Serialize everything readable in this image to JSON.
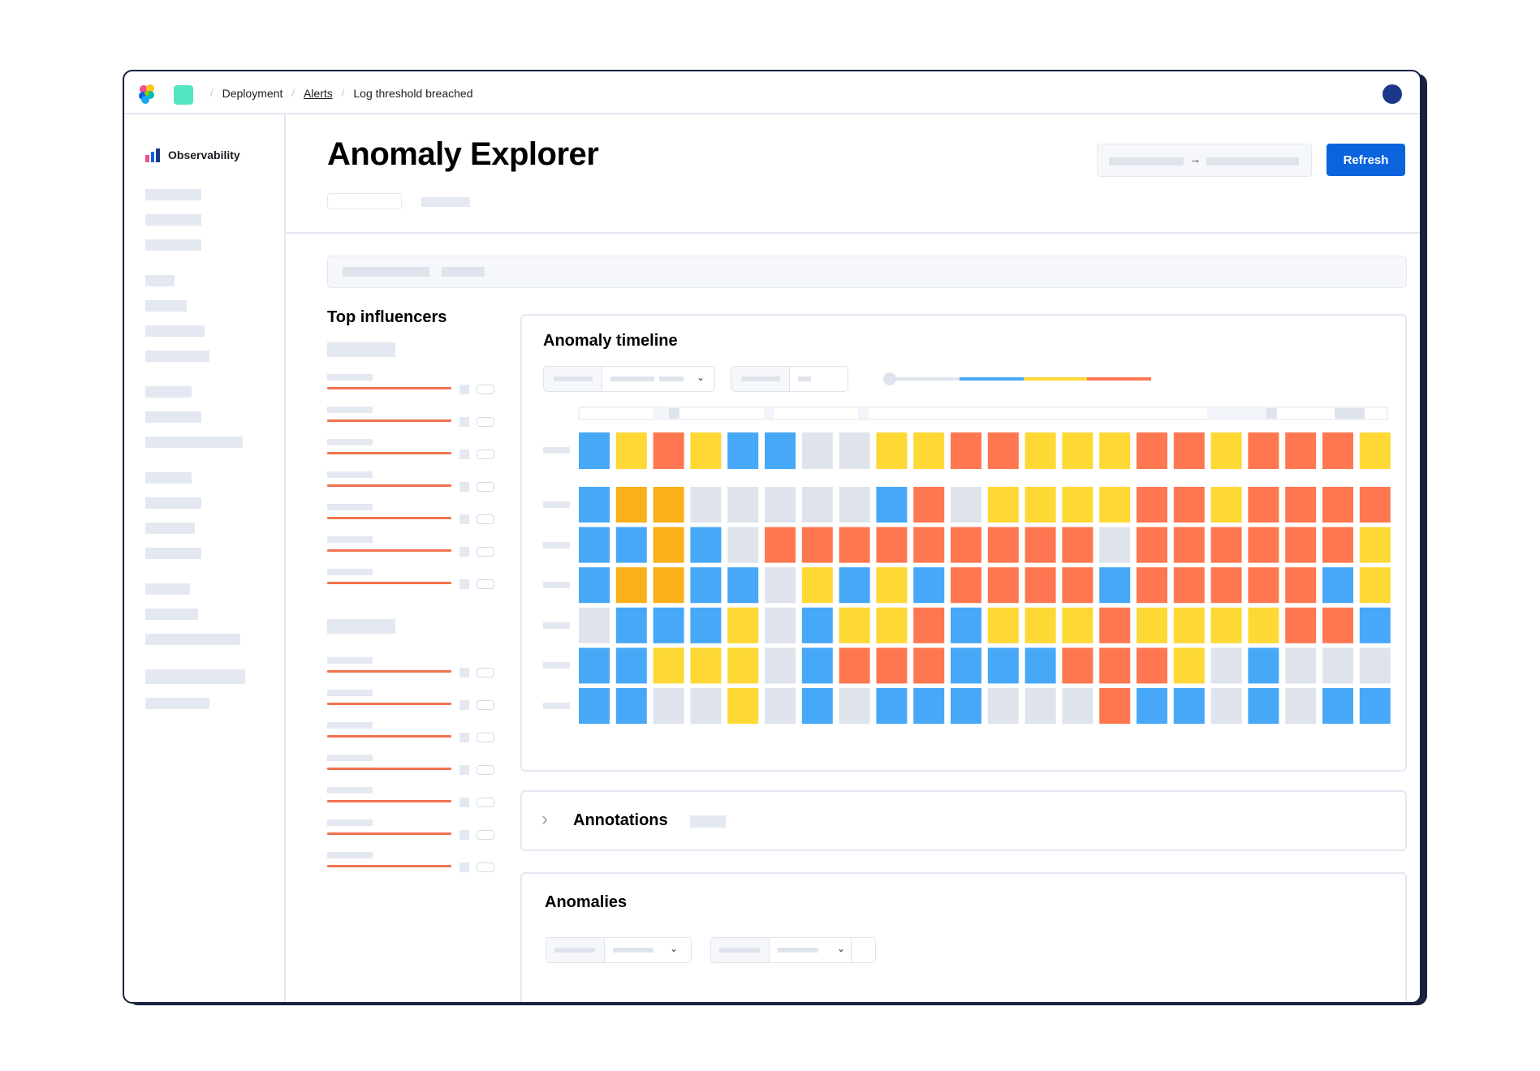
{
  "header": {
    "breadcrumbs": [
      "Deployment",
      "Alerts",
      "Log threshold breached"
    ]
  },
  "sidebar": {
    "app_title": "Observability"
  },
  "page": {
    "title": "Anomaly Explorer",
    "refresh_label": "Refresh",
    "date_arrow": "→"
  },
  "influencers": {
    "title": "Top influencers"
  },
  "timeline": {
    "title": "Anomaly timeline",
    "severity_colors": [
      "#47a8f8",
      "#fed834",
      "#ff7750"
    ],
    "overall_row": [
      "B",
      "Y",
      "R",
      "Y",
      "B",
      "B",
      "G",
      "G",
      "Y",
      "Y",
      "R",
      "R",
      "Y",
      "Y",
      "Y",
      "R",
      "R",
      "Y",
      "R",
      "R",
      "R",
      "Y"
    ],
    "rows": [
      [
        "B",
        "O",
        "O",
        "G",
        "G",
        "G",
        "G",
        "G",
        "B",
        "R",
        "G",
        "Y",
        "Y",
        "Y",
        "Y",
        "R",
        "R",
        "Y",
        "R",
        "R",
        "R",
        "R"
      ],
      [
        "B",
        "B",
        "O",
        "B",
        "G",
        "R",
        "R",
        "R",
        "R",
        "R",
        "R",
        "R",
        "R",
        "R",
        "G",
        "R",
        "R",
        "R",
        "R",
        "R",
        "R",
        "Y"
      ],
      [
        "B",
        "O",
        "O",
        "B",
        "B",
        "G",
        "Y",
        "B",
        "Y",
        "B",
        "R",
        "R",
        "R",
        "R",
        "B",
        "R",
        "R",
        "R",
        "R",
        "R",
        "B",
        "Y"
      ],
      [
        "G",
        "B",
        "B",
        "B",
        "Y",
        "G",
        "B",
        "Y",
        "Y",
        "R",
        "B",
        "Y",
        "Y",
        "Y",
        "R",
        "Y",
        "Y",
        "Y",
        "Y",
        "R",
        "R",
        "B"
      ],
      [
        "B",
        "B",
        "Y",
        "Y",
        "Y",
        "G",
        "B",
        "R",
        "R",
        "R",
        "B",
        "B",
        "B",
        "R",
        "R",
        "R",
        "Y",
        "G",
        "B",
        "G",
        "G",
        "G"
      ],
      [
        "B",
        "B",
        "G",
        "G",
        "Y",
        "G",
        "B",
        "G",
        "B",
        "B",
        "B",
        "G",
        "G",
        "G",
        "R",
        "B",
        "B",
        "G",
        "B",
        "G",
        "B",
        "B"
      ]
    ],
    "cell_colors": {
      "B": "#47a8f8",
      "Y": "#fed834",
      "R": "#ff7750",
      "O": "#f9b01a",
      "G": "#dfe4ec"
    }
  },
  "annotations": {
    "title": "Annotations"
  },
  "anomalies": {
    "title": "Anomalies"
  }
}
